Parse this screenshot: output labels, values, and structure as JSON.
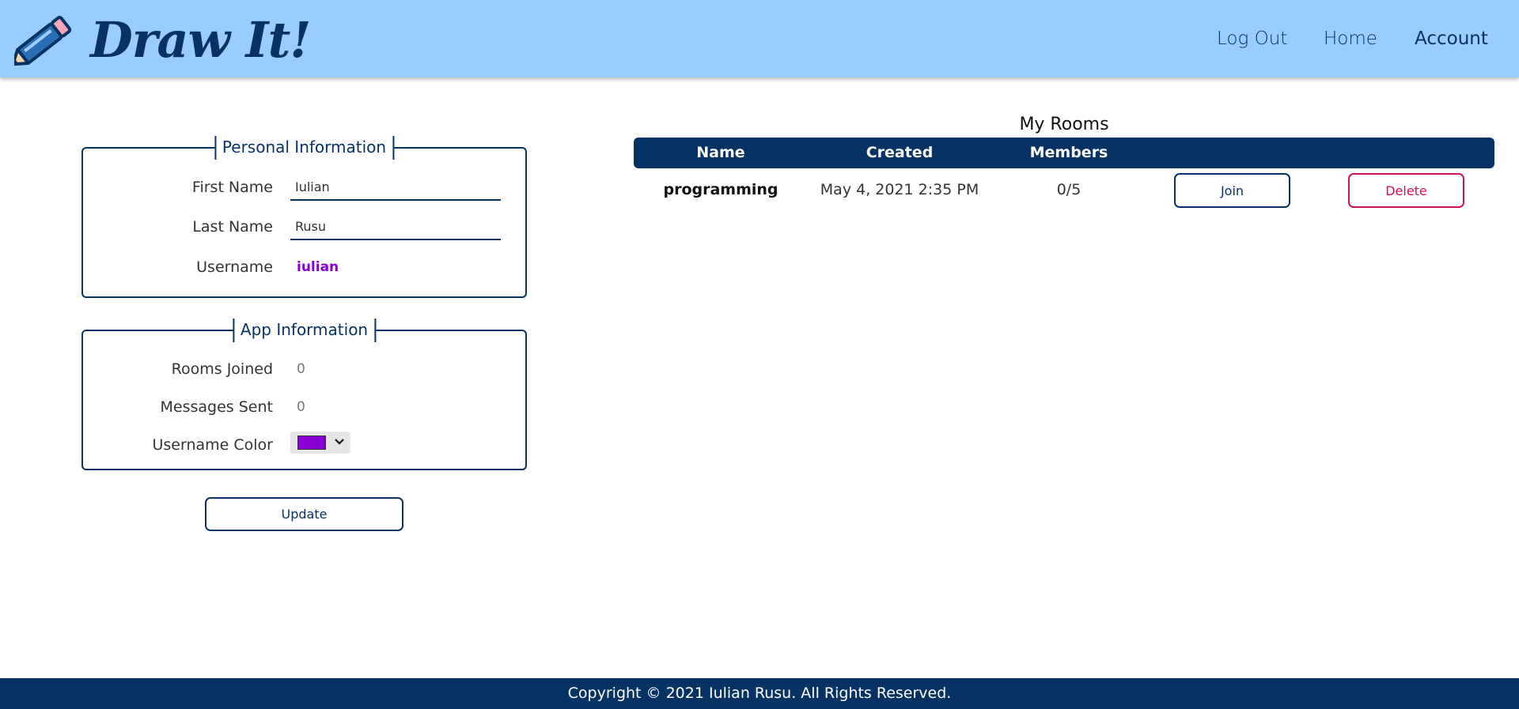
{
  "header": {
    "brand": "Draw It!",
    "nav": {
      "logout": "Log Out",
      "home": "Home",
      "account": "Account"
    }
  },
  "personal": {
    "legend": "Personal Information",
    "first_name_label": "First Name",
    "first_name_value": "Iulian",
    "last_name_label": "Last Name",
    "last_name_value": "Rusu",
    "username_label": "Username",
    "username_value": "iulian"
  },
  "app_info": {
    "legend": "App Information",
    "rooms_joined_label": "Rooms Joined",
    "rooms_joined_value": "0",
    "messages_sent_label": "Messages Sent",
    "messages_sent_value": "0",
    "username_color_label": "Username Color",
    "username_color": "#8a00d4"
  },
  "update_label": "Update",
  "rooms": {
    "title": "My Rooms",
    "columns": [
      "Name",
      "Created",
      "Members"
    ],
    "rows": [
      {
        "name": "programming",
        "created": "May 4, 2021 2:35 PM",
        "members": "0/5",
        "join_label": "Join",
        "delete_label": "Delete"
      }
    ]
  },
  "footer": {
    "copyright": "Copyright © 2021 Iulian Rusu. All Rights Reserved."
  },
  "colors": {
    "header_bg": "#99ccff",
    "navy": "#063264",
    "delete": "#cc1450"
  }
}
